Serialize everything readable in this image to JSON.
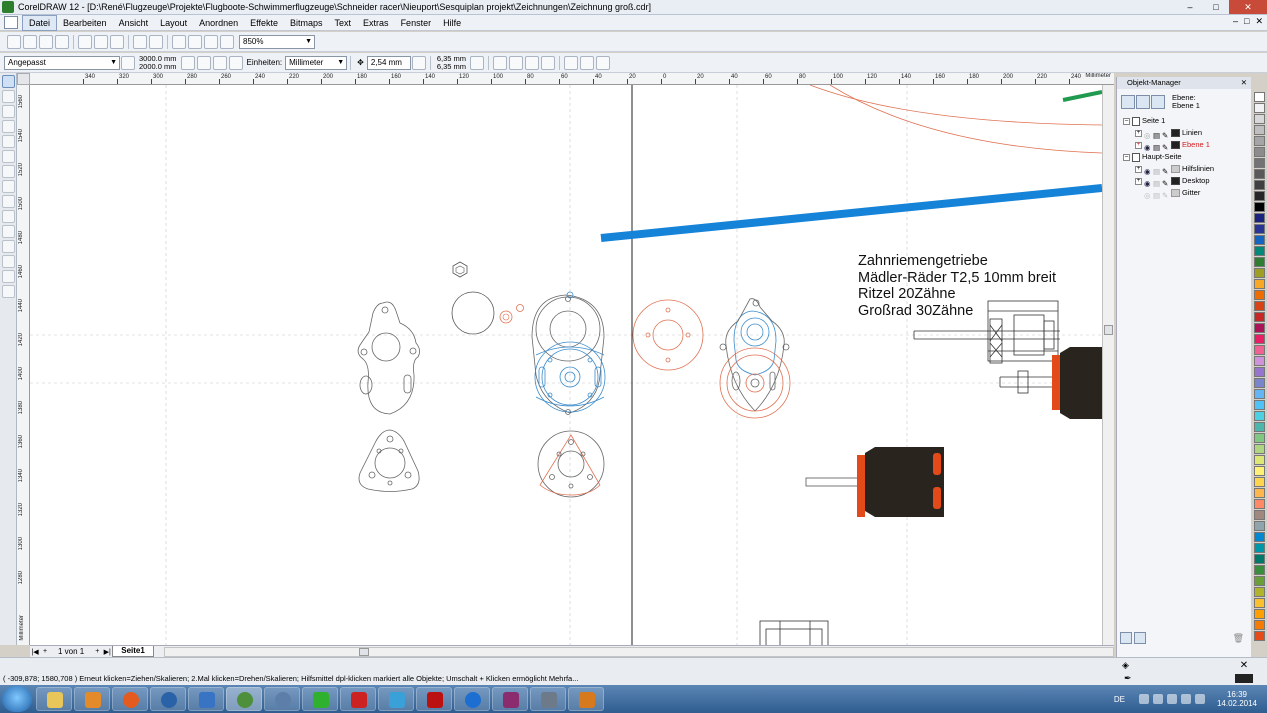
{
  "window": {
    "title": "CorelDRAW 12 - [D:\\René\\Flugzeuge\\Projekte\\Flugboote-Schwimmerflugzeuge\\Schneider racer\\Nieuport\\Sesquiplan projekt\\Zeichnungen\\Zeichnung groß.cdr]",
    "minimize": "–",
    "maximize": "□",
    "close": "✕"
  },
  "menu": [
    "Datei",
    "Bearbeiten",
    "Ansicht",
    "Layout",
    "Anordnen",
    "Effekte",
    "Bitmaps",
    "Text",
    "Extras",
    "Fenster",
    "Hilfe"
  ],
  "toolbar1": {
    "zoom": "850%"
  },
  "toolbar2": {
    "page_size": "Angepasst",
    "width": "3000.0 mm",
    "height": "2000.0 mm",
    "units_label": "Einheiten:",
    "units": "Millimeter",
    "nudge": "2,54 mm",
    "dup_x": "6,35 mm",
    "dup_y": "6,35 mm"
  },
  "hruler": {
    "unit": "Millimeter",
    "labels": [
      "340",
      "320",
      "300",
      "280",
      "260",
      "240",
      "220",
      "200",
      "180",
      "160",
      "140",
      "120",
      "100",
      "80",
      "60",
      "40",
      "20",
      "0",
      "20",
      "40",
      "60",
      "80",
      "100",
      "120",
      "140",
      "160",
      "180",
      "200",
      "220",
      "240"
    ]
  },
  "vruler": {
    "unit": "Millimeter",
    "labels": [
      "1560",
      "1540",
      "1520",
      "1500",
      "1480",
      "1460",
      "1440",
      "1420",
      "1400",
      "1380",
      "1360",
      "1340",
      "1320",
      "1300",
      "1280"
    ]
  },
  "canvas": {
    "note_lines": [
      "Zahnriemengetriebe",
      "Mädler-Räder T2,5 10mm breit",
      "Ritzel 20Zähne",
      "Großrad 30Zähne"
    ]
  },
  "pagebar": {
    "count": "1 von 1",
    "tab": "Seite1"
  },
  "object_manager": {
    "title": "Objekt-Manager",
    "layer_label": "Ebene:",
    "layer_name": "Ebene 1",
    "tree": [
      {
        "label": "Seite 1",
        "level": 0
      },
      {
        "label": "Linien",
        "level": 1
      },
      {
        "label": "Ebene 1",
        "level": 1,
        "active": true
      },
      {
        "label": "Haupt-Seite",
        "level": 0
      },
      {
        "label": "Hilfslinien",
        "level": 1
      },
      {
        "label": "Desktop",
        "level": 1
      },
      {
        "label": "Gitter",
        "level": 1
      }
    ]
  },
  "palette_colors": [
    "#ffffff",
    "#f2f2f2",
    "#d8d8d8",
    "#bfbfbf",
    "#a5a5a5",
    "#8c8c8c",
    "#737373",
    "#595959",
    "#404040",
    "#262626",
    "#000000",
    "#1a237e",
    "#283593",
    "#1565c0",
    "#00897b",
    "#2e7d32",
    "#9e9d24",
    "#f9a825",
    "#ef6c00",
    "#d84315",
    "#c62828",
    "#ad1457",
    "#e91e63",
    "#f06292",
    "#ce93d8",
    "#9575cd",
    "#7986cb",
    "#64b5f6",
    "#4fc3f7",
    "#4dd0e1",
    "#4db6ac",
    "#81c784",
    "#aed581",
    "#dce775",
    "#fff176",
    "#ffd54f",
    "#ffb74d",
    "#ff8a65",
    "#a1887f",
    "#90a4ae",
    "#0288d1",
    "#0097a7",
    "#00796b",
    "#388e3c",
    "#689f38",
    "#afb42b",
    "#fbc02d",
    "#ffa000",
    "#f57c00",
    "#e64a19"
  ],
  "status": {
    "text": "( -309,878; 1580,708 )  Erneut klicken=Ziehen/Skalieren; 2.Mal klicken=Drehen/Skalieren; Hilfsmittel dpl-klicken markiert alle Objekte; Umschalt + Klicken ermöglicht Mehrfa...",
    "fill_swatch": "✕"
  },
  "taskbar": {
    "lang": "DE",
    "time": "16:39",
    "date": "14.02.2014"
  }
}
